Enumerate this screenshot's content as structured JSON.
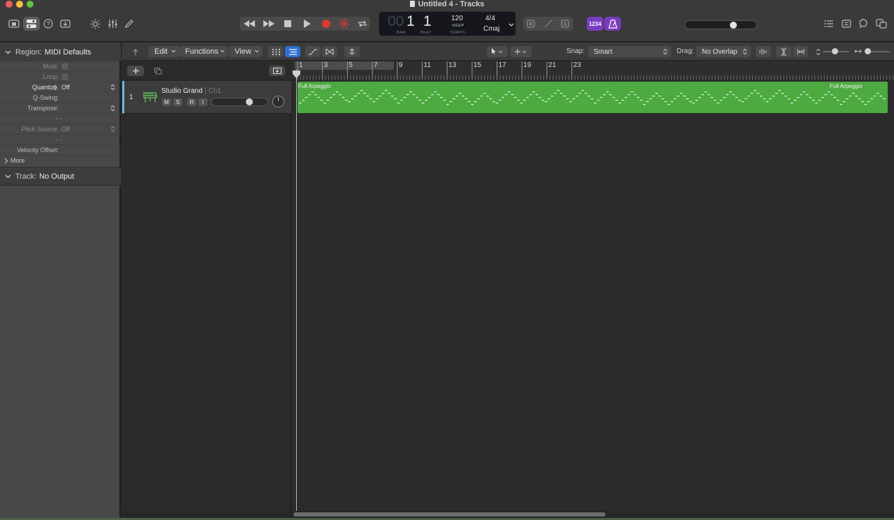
{
  "window": {
    "title": "Untitled 4 - Tracks",
    "traffic_colors": [
      "#ee5f57",
      "#f6bd3b",
      "#5fc33f"
    ]
  },
  "control_bar": {
    "lcd": {
      "bar_dim": "00",
      "bar": "1",
      "beat": "1",
      "bar_label": "BAR",
      "beat_label": "BEAT",
      "tempo": "120",
      "tempo_mode": "KEEP",
      "tempo_label": "TEMPO",
      "time_signature": "4/4",
      "key": "Cmaj"
    },
    "count_in_label": "1234",
    "record_color": "#d93b30",
    "accent_purple": "#7a3cbf",
    "master_volume_level": 0.7
  },
  "inspector": {
    "region_header_label": "Region:",
    "region_header_value": "MIDI Defaults",
    "rows": [
      {
        "key": "Mute:",
        "value": ""
      },
      {
        "key": "Loop:",
        "value": ""
      },
      {
        "key": "Quantize",
        "value": "Off"
      },
      {
        "key": "Q-Swing:",
        "value": ""
      },
      {
        "key": "Transpose:",
        "value": ""
      },
      {
        "key": "",
        "value": "- -"
      },
      {
        "key": "Pitch Source:",
        "value": "Off"
      },
      {
        "key": "",
        "value": "- -"
      },
      {
        "key": "Velocity Offset:",
        "value": ""
      }
    ],
    "more_label": "More",
    "track_header_label": "Track:",
    "track_header_value": "No Output"
  },
  "toolbar": {
    "edit_label": "Edit",
    "functions_label": "Functions",
    "view_label": "View",
    "snap_label": "Snap:",
    "snap_value": "Smart",
    "drag_label": "Drag:",
    "drag_value": "No Overlap"
  },
  "track": {
    "number": "1",
    "name": "Studio Grand",
    "channel": "| Ch1",
    "buttons": [
      "M",
      "S",
      "R",
      "I"
    ],
    "volume_level": 0.7
  },
  "ruler": {
    "bars": [
      "1",
      "3",
      "5",
      "7",
      "9",
      "11",
      "13",
      "15",
      "17",
      "19",
      "21",
      "23"
    ]
  },
  "region": {
    "name": "Full Arpeggio",
    "name_repeat": "Full Arpeggio",
    "color": "#4caa41"
  },
  "icons": {
    "library": "library-icon",
    "inspector": "inspector-icon",
    "help": "help-icon",
    "download": "download-icon",
    "brightness": "brightness-icon",
    "mixer": "mixer-icon",
    "pencil": "pencil-icon",
    "rewind": "rewind-icon",
    "fast_forward": "fast-forward-icon",
    "stop": "stop-icon",
    "play": "play-icon",
    "record": "record-icon",
    "capture": "capture-record-icon",
    "cycle": "cycle-icon",
    "list": "list-icon",
    "notepad": "notepad-icon",
    "loops": "loops-icon",
    "browser": "browser-icon"
  }
}
